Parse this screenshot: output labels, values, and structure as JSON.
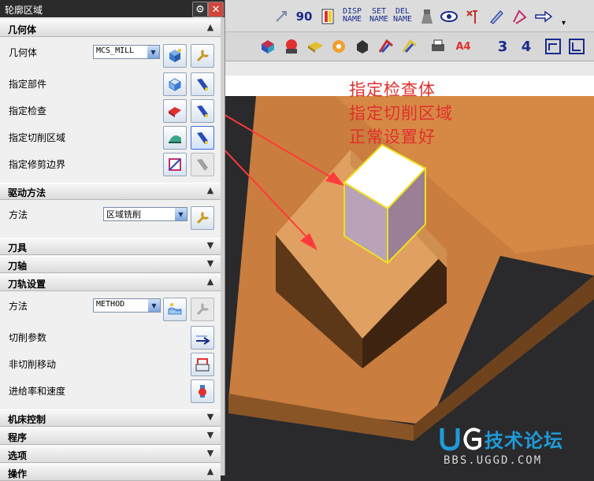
{
  "dialog": {
    "title": "轮廓区域",
    "sections": {
      "geometry": {
        "label": "几何体",
        "geometry_label": "几何体",
        "geometry_value": "MCS_MILL",
        "part_label": "指定部件",
        "check_label": "指定检查",
        "cut_area_label": "指定切削区域",
        "trim_label": "指定修剪边界"
      },
      "drive": {
        "label": "驱动方法",
        "method_label": "方法",
        "method_value": "区域铣削"
      },
      "tool": {
        "label": "刀具"
      },
      "axis": {
        "label": "刀轴"
      },
      "path": {
        "label": "刀轨设置",
        "method_label": "方法",
        "method_value": "METHOD",
        "cut_params_label": "切削参数",
        "non_cut_label": "非切削移动",
        "feeds_label": "进给率和速度"
      },
      "machine": {
        "label": "机床控制"
      },
      "program": {
        "label": "程序"
      },
      "options": {
        "label": "选项"
      },
      "ops": {
        "label": "操作"
      }
    }
  },
  "toolbar": {
    "disp_name": "DISP\nNAME",
    "set_name": "SET\nNAME",
    "del_name": "DEL\nNAME",
    "rotate_label": "90",
    "layer3": "3",
    "layer4": "4",
    "a4": "A4"
  },
  "annotation": {
    "line1": "指定检查体",
    "line2": "指定切削区域",
    "line3": "正常设置好"
  },
  "watermark": {
    "title": "技术论坛",
    "url": "BBS.UGGD.COM"
  },
  "colors": {
    "annotation": "#e0302d",
    "viewport_bg": "#2a2a2d",
    "part": "#d98a47",
    "check_box": "#ffffff"
  }
}
